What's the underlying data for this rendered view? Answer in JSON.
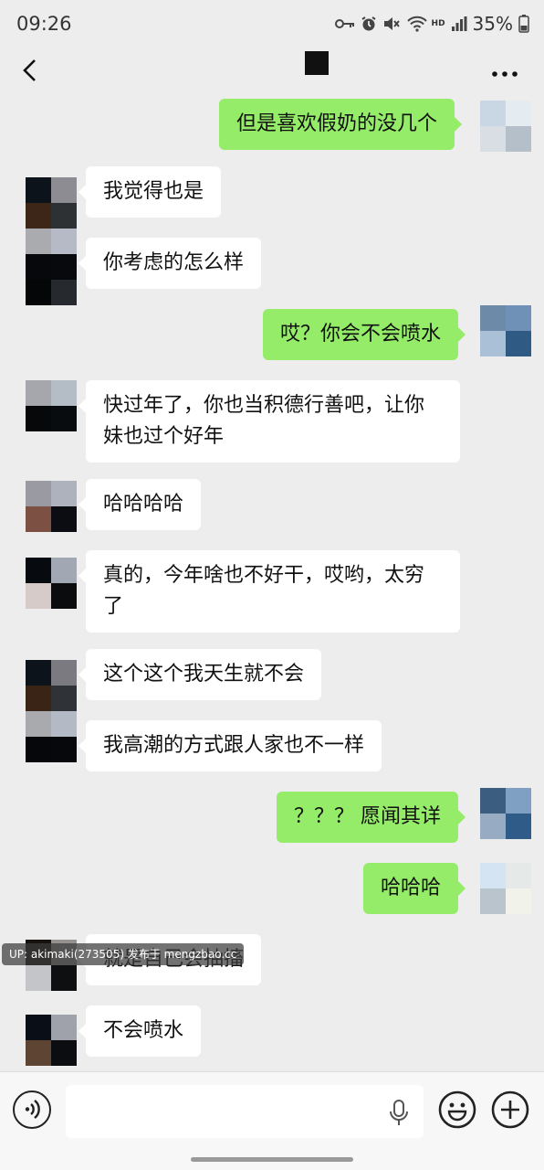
{
  "status_bar": {
    "time": "09:26",
    "hd_label": "HD",
    "battery_percent": "35%",
    "icons": [
      "key-icon",
      "alarm-icon",
      "mute-icon",
      "wifi-icon",
      "signal-icon",
      "battery-icon"
    ]
  },
  "header": {
    "title_redacted": true,
    "back_icon": "chevron-left-icon",
    "more_icon": "more-icon"
  },
  "messages": [
    {
      "side": "out",
      "text": "但是喜欢假奶的没几个"
    },
    {
      "side": "in",
      "text": "我觉得也是"
    },
    {
      "side": "in",
      "text": "你考虑的怎么样"
    },
    {
      "side": "out",
      "text": "哎？你会不会喷水"
    },
    {
      "side": "in",
      "text": "快过年了，你也当积德行善吧，让你妹也过个好年"
    },
    {
      "side": "in",
      "text": "哈哈哈哈"
    },
    {
      "side": "in",
      "text": "真的，今年啥也不好干，哎哟，太穷了"
    },
    {
      "side": "in",
      "text": "这个这个我天生就不会"
    },
    {
      "side": "in",
      "text": "我高潮的方式跟人家也不一样"
    },
    {
      "side": "out",
      "text": "？？？ 愿闻其详"
    },
    {
      "side": "out",
      "text": "哈哈哈"
    },
    {
      "side": "in",
      "text": "就是自己会抽搐"
    },
    {
      "side": "in",
      "text": "不会喷水"
    }
  ],
  "watermark": {
    "text": "UP: akimaki(273505) 发布于 mengzbao.cc"
  },
  "input_bar": {
    "value": "",
    "icons": [
      "voice-icon",
      "microphone-icon",
      "emoji-icon",
      "plus-icon"
    ]
  },
  "colors": {
    "background": "#ededed",
    "outgoing_bubble": "#95ec69",
    "incoming_bubble": "#ffffff"
  }
}
